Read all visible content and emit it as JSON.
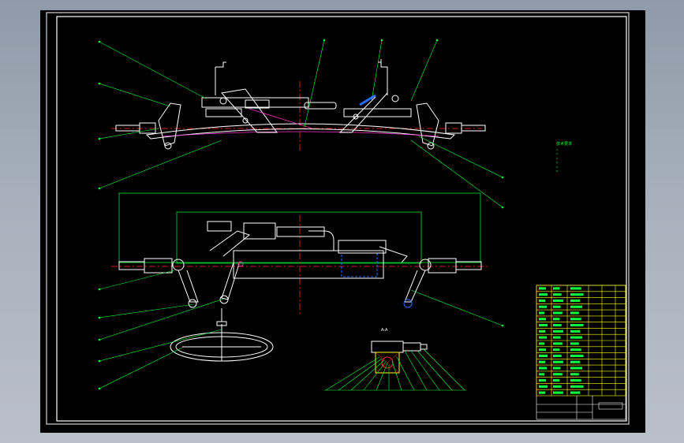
{
  "window": {
    "background": "#9aa4b1",
    "sheet_background": "#000000"
  },
  "colors": {
    "frame": "#ffffff",
    "parts": "#ffffff",
    "leaders": "#00ff3c",
    "centerlines": "#ff2a2a",
    "highlight_blue": "#2a6bff",
    "highlight_magenta": "#ff33cc",
    "title_block": "#ffff00",
    "dimension": "#00ff3c"
  },
  "section_label": "A-A",
  "dimension_labels": {
    "overall_width": "—",
    "inner_width": "—"
  },
  "technical_notes": {
    "title": "技术要求",
    "lines": [
      "1.",
      "2.",
      "3.",
      "4.",
      "5.",
      "6."
    ]
  },
  "title_block": {
    "drawing_name": "",
    "rows": 18
  },
  "views": [
    {
      "name": "front-view"
    },
    {
      "name": "top-view"
    },
    {
      "name": "steering-wheel-view"
    },
    {
      "name": "section-detail-view"
    }
  ]
}
